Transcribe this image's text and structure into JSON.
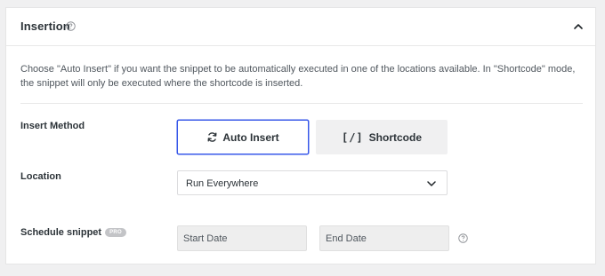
{
  "panel": {
    "title": "Insertion",
    "help_icon": "question-circle-icon",
    "collapse_icon": "chevron-up-icon",
    "description": "Choose \"Auto Insert\" if you want the snippet to be automatically executed in one of the locations available. In \"Shortcode\" mode, the snippet will only be executed where the shortcode is inserted."
  },
  "insert_method": {
    "label": "Insert Method",
    "options": [
      {
        "label": "Auto Insert",
        "icon": "refresh-icon",
        "selected": true
      },
      {
        "label": "Shortcode",
        "icon_text": "[/]",
        "selected": false
      }
    ]
  },
  "location": {
    "label": "Location",
    "selected": "Run Everywhere",
    "icon": "chevron-down-icon"
  },
  "schedule": {
    "label": "Schedule snippet",
    "badge": "PRO",
    "start_placeholder": "Start Date",
    "end_placeholder": "End Date",
    "help_icon": "question-circle-icon"
  },
  "colors": {
    "accent": "#3858e9",
    "background": "#f0f0f1",
    "panel": "#ffffff"
  }
}
